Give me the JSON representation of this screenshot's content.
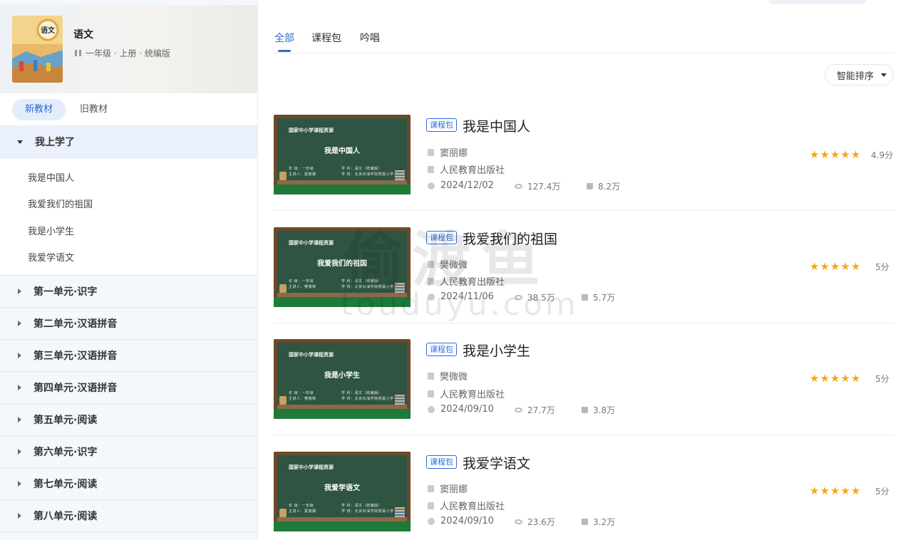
{
  "book": {
    "cover_text": "语文",
    "title": "语文",
    "meta": "一年级 · 上册 · 统编版"
  },
  "editions": {
    "new": "新教材",
    "old": "旧教材"
  },
  "units": [
    {
      "label": "我上学了",
      "open": true,
      "lessons": [
        "我是中国人",
        "我爱我们的祖国",
        "我是小学生",
        "我爱学语文"
      ]
    },
    {
      "label": "第一单元·识字"
    },
    {
      "label": "第二单元·汉语拼音"
    },
    {
      "label": "第三单元·汉语拼音"
    },
    {
      "label": "第四单元·汉语拼音"
    },
    {
      "label": "第五单元·阅读"
    },
    {
      "label": "第六单元·识字"
    },
    {
      "label": "第七单元·阅读"
    },
    {
      "label": "第八单元·阅读"
    }
  ],
  "tabs": [
    "全部",
    "课程包",
    "吟唱"
  ],
  "sort_label": "智能排序",
  "thumb_header": "国家中小学课程资源",
  "thumb_grade": "年  级：一年级",
  "thumb_subject": "学  科：语文（统编版）",
  "thumb_school": "学  校：北京石油学院附属小学",
  "cards": [
    {
      "badge": "课程包",
      "title": "我是中国人",
      "author": "窦丽娜",
      "publisher": "人民教育出版社",
      "date": "2024/12/02",
      "views": "127.4万",
      "likes": "8.2万",
      "rating": 4.9,
      "score": "4.9分",
      "thumb_speaker": "主讲人：窦丽娜"
    },
    {
      "badge": "课程包",
      "title": "我爱我们的祖国",
      "author": "樊微微",
      "publisher": "人民教育出版社",
      "date": "2024/11/06",
      "views": "38.5万",
      "likes": "5.7万",
      "rating": 5,
      "score": "5分",
      "thumb_speaker": "主讲人：樊微微"
    },
    {
      "badge": "课程包",
      "title": "我是小学生",
      "author": "樊微微",
      "publisher": "人民教育出版社",
      "date": "2024/09/10",
      "views": "27.7万",
      "likes": "3.8万",
      "rating": 5,
      "score": "5分",
      "thumb_speaker": "主讲人：樊微微"
    },
    {
      "badge": "课程包",
      "title": "我爱学语文",
      "author": "窦丽娜",
      "publisher": "人民教育出版社",
      "date": "2024/09/10",
      "views": "23.6万",
      "likes": "3.2万",
      "rating": 5,
      "score": "5分",
      "thumb_speaker": "主讲人：窦丽娜"
    }
  ],
  "watermark": {
    "line1": "偷渡鱼",
    "line2": "touduyu.com"
  },
  "colors": {
    "accent": "#2f6bd7",
    "star": "#f7a51a",
    "chalkboard": "#2f5441",
    "sidebar_bg": "#f4f7fc"
  }
}
